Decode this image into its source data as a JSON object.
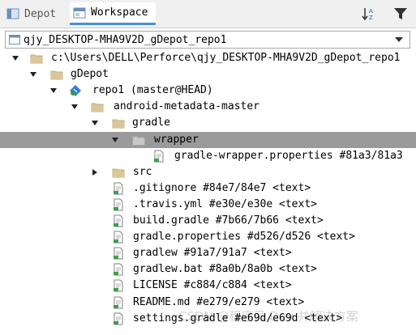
{
  "tabs": [
    {
      "label": "Depot"
    },
    {
      "label": "Workspace"
    }
  ],
  "workspace_select": {
    "value": "qjy_DESKTOP-MHA9V2D_gDepot_repo1"
  },
  "tree": [
    {
      "label": "c:\\Users\\DELL\\Perforce\\qjy_DESKTOP-MHA9V2D_gDepot_repo1",
      "icon": "folder",
      "expanded": true
    },
    {
      "label": "gDepot",
      "icon": "folder",
      "expanded": true
    },
    {
      "label": "repo1 (master@HEAD)",
      "icon": "repo",
      "expanded": true
    },
    {
      "label": "android-metadata-master",
      "icon": "folder",
      "expanded": true
    },
    {
      "label": "gradle",
      "icon": "folder",
      "expanded": true
    },
    {
      "label": "wrapper",
      "icon": "folder",
      "expanded": true,
      "selected": true
    },
    {
      "label": "gradle-wrapper.properties #81a3/81a3",
      "icon": "file"
    },
    {
      "label": "src",
      "icon": "folder",
      "expanded": false
    },
    {
      "label": ".gitignore #84e7/84e7 <text>",
      "icon": "file"
    },
    {
      "label": ".travis.yml #e30e/e30e <text>",
      "icon": "file"
    },
    {
      "label": "build.gradle #7b66/7b66 <text>",
      "icon": "file"
    },
    {
      "label": "gradle.properties #d526/d526 <text>",
      "icon": "file"
    },
    {
      "label": "gradlew #91a7/91a7 <text>",
      "icon": "file"
    },
    {
      "label": "gradlew.bat #8a0b/8a0b <text>",
      "icon": "file"
    },
    {
      "label": "LICENSE #c884/c884 <text>",
      "icon": "file"
    },
    {
      "label": "README.md #e279/e279 <text>",
      "icon": "file"
    },
    {
      "label": "settings.gradle #e69d/e69d <text>",
      "icon": "file"
    }
  ],
  "watermark": "CSDN @程序员 Dev 并解决方案"
}
